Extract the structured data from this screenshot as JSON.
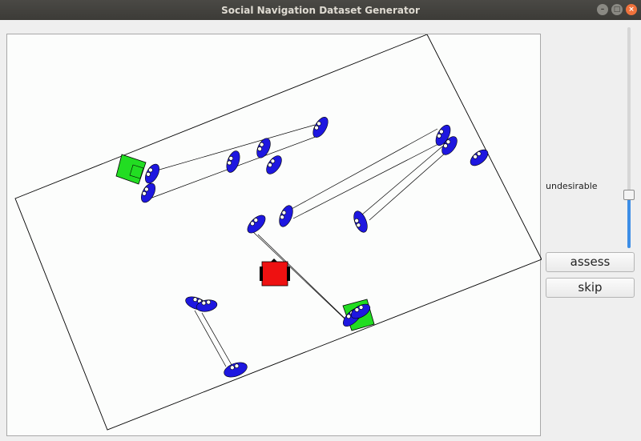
{
  "window": {
    "title": "Social Navigation Dataset Generator"
  },
  "window_buttons": {
    "minimize": "–",
    "maximize": "□",
    "close": "×"
  },
  "slider": {
    "label": "undesirable",
    "value_fraction": 0.26
  },
  "buttons": {
    "assess": "assess",
    "skip": "skip"
  },
  "colors": {
    "human": "#1e17e0",
    "goal_object": "#22dd22",
    "robot": "#ee1111",
    "slider_fill": "#3d8ee6"
  },
  "icons": [
    "person-icon",
    "goal-box-icon",
    "robot-icon"
  ]
}
